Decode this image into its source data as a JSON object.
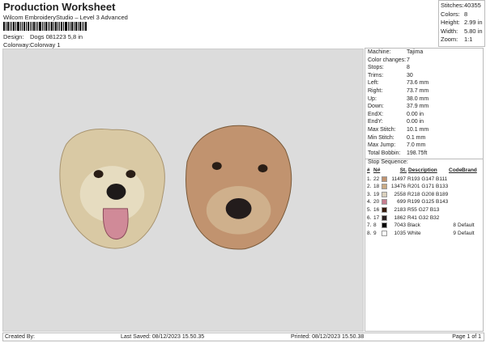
{
  "header": {
    "title": "Production Worksheet",
    "subtitle": "Wilcom EmbroideryStudio – Level 3 Advanced",
    "design_label": "Design:",
    "design_value": "Dogs 081223 5,8 in",
    "colorway_label": "Colorway:",
    "colorway_value": "Colorway 1"
  },
  "stats": [
    {
      "label": "Stitches:",
      "value": "40355"
    },
    {
      "label": "Colors:",
      "value": "8"
    },
    {
      "label": "Height:",
      "value": "2.99 in"
    },
    {
      "label": "Width:",
      "value": "5.80 in"
    },
    {
      "label": "Zoom:",
      "value": "1:1"
    }
  ],
  "details": [
    {
      "label": "Machine:",
      "value": "Tajima"
    },
    {
      "label": "Color changes:",
      "value": "7"
    },
    {
      "label": "Stops:",
      "value": "8"
    },
    {
      "label": "Trims:",
      "value": "30"
    },
    {
      "label": "Left:",
      "value": "73.6 mm"
    },
    {
      "label": "Right:",
      "value": "73.7 mm"
    },
    {
      "label": "Up:",
      "value": "38.0 mm"
    },
    {
      "label": "Down:",
      "value": "37.9 mm"
    },
    {
      "label": "EndX:",
      "value": "0.00 in"
    },
    {
      "label": "EndY:",
      "value": "0.00 in"
    },
    {
      "label": "Max Stitch:",
      "value": "10.1 mm"
    },
    {
      "label": "Min Stitch:",
      "value": "0.1 mm"
    },
    {
      "label": "Max Jump:",
      "value": "7.0 mm"
    },
    {
      "label": "Total Bobbin:",
      "value": "198.75ft"
    }
  ],
  "stop_sequence": {
    "title": "Stop Sequence:",
    "headers": {
      "num": "#",
      "n": "N#",
      "st": "St.",
      "desc": "Description",
      "code": "Code",
      "brand": "Brand"
    },
    "rows": [
      {
        "num": "1.",
        "n": "22",
        "color": "#c1936f",
        "st": "11497",
        "desc": "R193 G147 B111",
        "code": "",
        "brand": ""
      },
      {
        "num": "2.",
        "n": "18",
        "color": "#c9ab85",
        "st": "13476",
        "desc": "R201 G171 B133",
        "code": "",
        "brand": ""
      },
      {
        "num": "3.",
        "n": "19",
        "color": "#dad0bd",
        "st": "2558",
        "desc": "R218 G208 B189",
        "code": "",
        "brand": ""
      },
      {
        "num": "4.",
        "n": "20",
        "color": "#c77d8f",
        "st": "699",
        "desc": "R199 G125 B143",
        "code": "",
        "brand": ""
      },
      {
        "num": "5.",
        "n": "16",
        "color": "#371b0d",
        "st": "2183",
        "desc": "R55 G27 B13",
        "code": "",
        "brand": ""
      },
      {
        "num": "6.",
        "n": "17",
        "color": "#292020",
        "st": "1862",
        "desc": "R41 G32 B32",
        "code": "",
        "brand": ""
      },
      {
        "num": "7.",
        "n": "8",
        "color": "#000000",
        "st": "7043",
        "desc": "Black",
        "code": "8",
        "brand": "Default"
      },
      {
        "num": "8.",
        "n": "9",
        "color": "#ffffff",
        "st": "1035",
        "desc": "White",
        "code": "9",
        "brand": "Default"
      }
    ]
  },
  "footer": {
    "created": "Created By:",
    "saved": "Last Saved: 08/12/2023 15.50.35",
    "printed": "Printed: 08/12/2023 15.50.38",
    "page": "Page 1 of 1"
  }
}
